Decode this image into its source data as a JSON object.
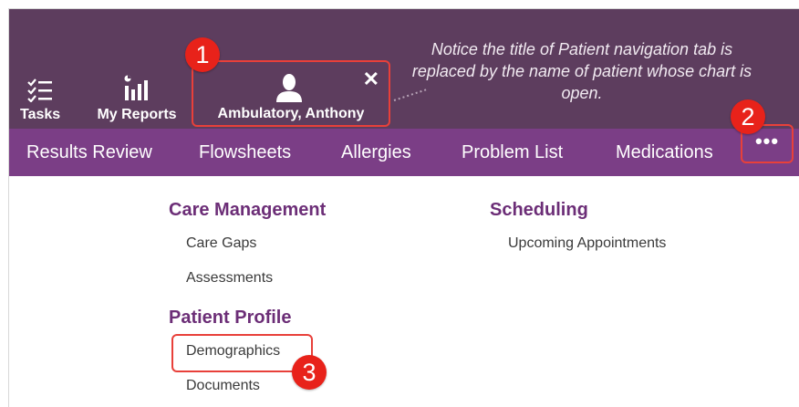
{
  "toolbar": {
    "tasks_label": "Tasks",
    "reports_label": "My Reports",
    "patient_name": "Ambulatory, Anthony",
    "close_glyph": "✕"
  },
  "annotation": {
    "note": "Notice the title of Patient navigation tab is replaced by the name of patient whose chart is open.",
    "callout_1": "1",
    "callout_2": "2",
    "callout_3": "3"
  },
  "nav": {
    "items": [
      "Results Review",
      "Flowsheets",
      "Allergies",
      "Problem List",
      "Medications"
    ],
    "more_label": "•••"
  },
  "menu": {
    "care_management": {
      "heading": "Care Management",
      "items": [
        "Care Gaps",
        "Assessments"
      ]
    },
    "scheduling": {
      "heading": "Scheduling",
      "items": [
        "Upcoming Appointments"
      ]
    },
    "patient_profile": {
      "heading": "Patient Profile",
      "items": [
        "Demographics",
        "Documents"
      ]
    }
  },
  "colors": {
    "topbar": "#5d3d5e",
    "navbar": "#7b3e86",
    "heading": "#6c2e77",
    "callout": "#e8221a"
  }
}
